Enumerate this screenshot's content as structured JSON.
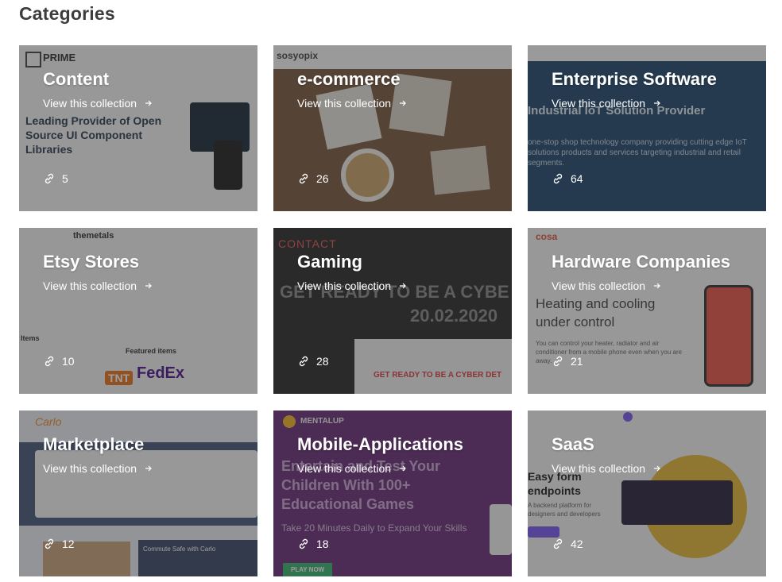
{
  "page": {
    "title": "Categories"
  },
  "link_label": "View this collection",
  "colors": {
    "overlay": "rgba(40,40,40,0.45)",
    "text": "#ffffff",
    "heading": "#3d3d3d"
  },
  "categories": [
    {
      "name": "Content",
      "count": "5"
    },
    {
      "name": "e-commerce",
      "count": "26"
    },
    {
      "name": "Enterprise Software",
      "count": "64"
    },
    {
      "name": "Etsy Stores",
      "count": "10"
    },
    {
      "name": "Gaming",
      "count": "28"
    },
    {
      "name": "Hardware Companies",
      "count": "21"
    },
    {
      "name": "Marketplace",
      "count": "12"
    },
    {
      "name": "Mobile-Applications",
      "count": "18"
    },
    {
      "name": "SaaS",
      "count": "42"
    }
  ],
  "thumbnails": {
    "content": {
      "brand": "PRIME",
      "headline": "Leading Provider of Open Source UI Component Libraries"
    },
    "ecommerce": {
      "brand": "sosyopix"
    },
    "enterprise": {
      "headline": "Industrial IoT Solution Provider",
      "body": "one-stop shop technology company providing cutting edge IoT solutions products and services targeting industrial and retail segments."
    },
    "etsy": {
      "brand": "themetals",
      "section1": "Items",
      "section2": "Featured items",
      "logo1": "TNT",
      "logo2": "FedEx"
    },
    "gaming": {
      "brand": "CONTACT",
      "headline": "GET READY TO BE A CYBE",
      "date": "20.02.2020",
      "sub": "GET READY TO BE A CYBER DET"
    },
    "hardware": {
      "brand": "cosa",
      "headline": "Heating and cooling under control",
      "body": "You can control your heater, radiator and air conditioner from a mobile phone even when you are away."
    },
    "marketplace": {
      "brand": "Carlo",
      "label": "Commute Safe with Carlo"
    },
    "mobile": {
      "brand": "MENTALUP",
      "headline": "Entertain and Test Your Children With 100+ Educational Games",
      "body": "Take 20 Minutes Daily to Expand Your Skills",
      "cta": "PLAY NOW"
    },
    "saas": {
      "headline": "Easy form endpoints",
      "body": "A backend platform for designers and developers"
    }
  }
}
